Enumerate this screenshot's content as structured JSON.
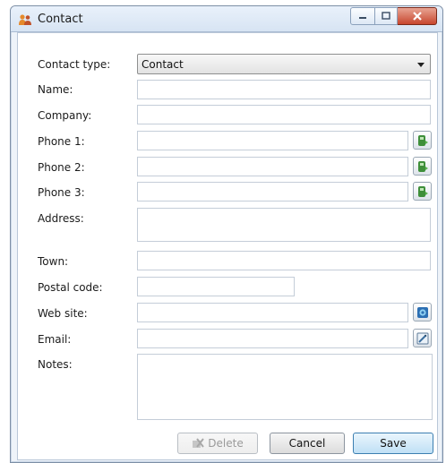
{
  "window": {
    "title": "Contact"
  },
  "form": {
    "contact_type": {
      "label": "Contact type:",
      "value": "Contact"
    },
    "name": {
      "label": "Name:",
      "value": ""
    },
    "company": {
      "label": "Company:",
      "value": ""
    },
    "phone1": {
      "label": "Phone 1:",
      "value": ""
    },
    "phone2": {
      "label": "Phone 2:",
      "value": ""
    },
    "phone3": {
      "label": "Phone 3:",
      "value": ""
    },
    "address": {
      "label": "Address:",
      "value": ""
    },
    "town": {
      "label": "Town:",
      "value": ""
    },
    "postal_code": {
      "label": "Postal code:",
      "value": ""
    },
    "web_site": {
      "label": "Web site:",
      "value": ""
    },
    "email": {
      "label": "Email:",
      "value": ""
    },
    "notes": {
      "label": "Notes:",
      "value": ""
    }
  },
  "buttons": {
    "delete": "Delete",
    "cancel": "Cancel",
    "save": "Save"
  },
  "icons": {
    "app": "contact-people-icon",
    "phone": "phone-call-icon",
    "web": "globe-icon",
    "email": "compose-email-icon",
    "delete": "delete-x-icon"
  }
}
